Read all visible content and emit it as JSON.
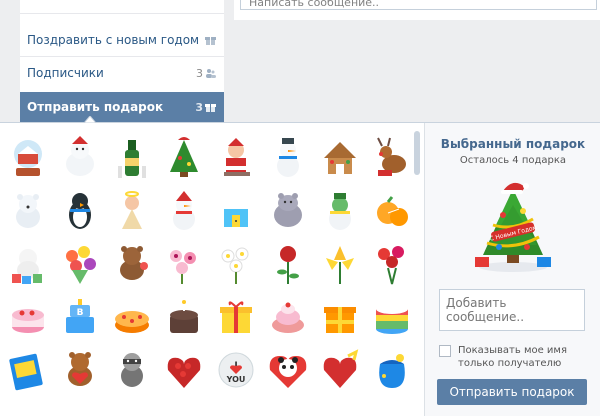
{
  "menu": {
    "items": [
      {
        "label": "Поздравить с новым годом",
        "count": ""
      },
      {
        "label": "Подписчики",
        "count": "3"
      },
      {
        "label": "Отправить подарок",
        "count": "3"
      }
    ]
  },
  "message_top": {
    "placeholder": "Написать сообщение.."
  },
  "side": {
    "title": "Выбранный подарок",
    "subtitle": "Осталось 4 подарка",
    "tree_banner": "С Новым Годом",
    "message_placeholder": "Добавить сообщение..",
    "checkbox_label": "Показывать мое имя только получателю",
    "send_label": "Отправить подарок"
  },
  "gifts": [
    "snow-globe",
    "polar-bear",
    "champagne",
    "christmas-tree",
    "santa-sleigh",
    "snowman",
    "gingerbread-house",
    "reindeer",
    "polar-bear-cub",
    "penguin",
    "angel",
    "snowman-hat",
    "snow-house",
    "hippo",
    "frog-snowman",
    "mandarin",
    "teddy-blocks",
    "flower-bouquet",
    "teddy-flowers",
    "orchid",
    "daisies",
    "red-rose",
    "lilies",
    "tulip-bouquet",
    "strawberry-cake",
    "blue-cake",
    "orange-cake",
    "chocolate-cake",
    "gift-box-yellow",
    "pink-cake",
    "gift-box-orange",
    "rainbow-cake",
    "blue-book",
    "teddy-heart",
    "raccoon",
    "rose-heart",
    "i-love-you",
    "panda-heart",
    "heart-box",
    "blue-bag"
  ],
  "colors": {
    "accent": "#5b7fa6",
    "link": "#2a5885",
    "background": "#edeef0"
  }
}
